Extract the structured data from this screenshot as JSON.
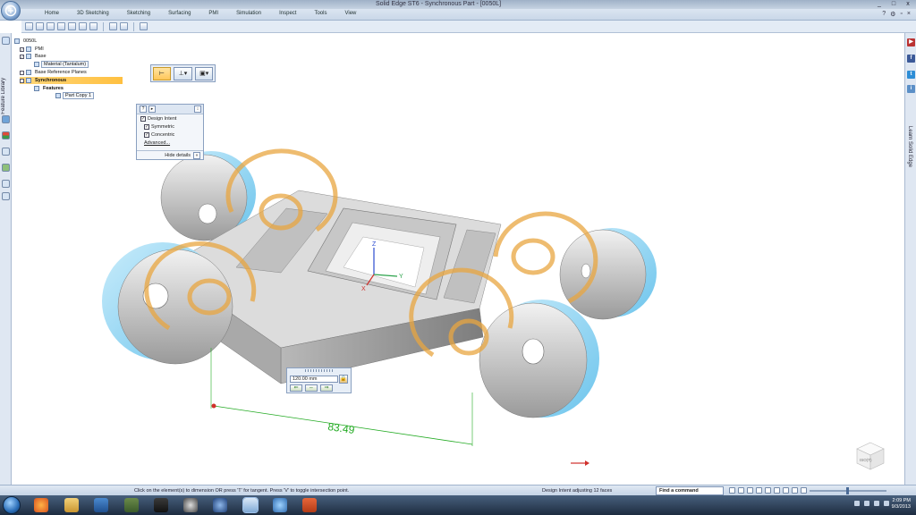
{
  "window": {
    "title": "Solid Edge ST6 - Synchronous Part - [0050L]",
    "controls": [
      "_",
      "□",
      "x"
    ]
  },
  "menu": {
    "tabs": [
      "Home",
      "3D Sketching",
      "Sketching",
      "Surfacing",
      "PMI",
      "Simulation",
      "Inspect",
      "Tools",
      "View"
    ]
  },
  "left_rail": {
    "tab_label": "Feature Library"
  },
  "right_rail": {
    "label": "Learn Solid Edge"
  },
  "tree": {
    "items": [
      {
        "label": "0050L",
        "checked": false
      },
      {
        "label": "PMI",
        "checked": true
      },
      {
        "label": "Base",
        "checked": true
      },
      {
        "label": "Material (Tantalum)",
        "checked": false
      },
      {
        "label": "Base Reference Planes",
        "checked": false
      },
      {
        "label": "Synchronous",
        "checked": false
      },
      {
        "label": "Features",
        "checked": false
      },
      {
        "label": "Part Copy 1",
        "checked": false
      }
    ]
  },
  "design_intent": {
    "title": "Design Intent",
    "options": [
      {
        "label": "Symmetric",
        "checked": true
      },
      {
        "label": "Concentric",
        "checked": true
      }
    ],
    "advanced_label": "Advanced...",
    "hide_label": "Hide details"
  },
  "dimension": {
    "value_label": "83.49",
    "input_value": "120.00 mm",
    "color": "#22aa22"
  },
  "axes": {
    "x": "X",
    "y": "Y",
    "z": "Z"
  },
  "viewcube": {
    "label": "ISO(T)"
  },
  "status": {
    "prompt": "Click on the element(s) to dimension OR press 'T' for tangent.  Press 'V' to toggle intersection point.",
    "message": "Design Intent adjusting 12 faces",
    "find_command": "Find a command"
  },
  "taskbar": {
    "time": "2:09 PM",
    "date": "9/3/2013"
  },
  "colors": {
    "accent_orange": "#e8a640",
    "face_blue": "#8fd3f0",
    "highlight_yellow": "#ffc040",
    "dimension_green": "#22aa22"
  }
}
